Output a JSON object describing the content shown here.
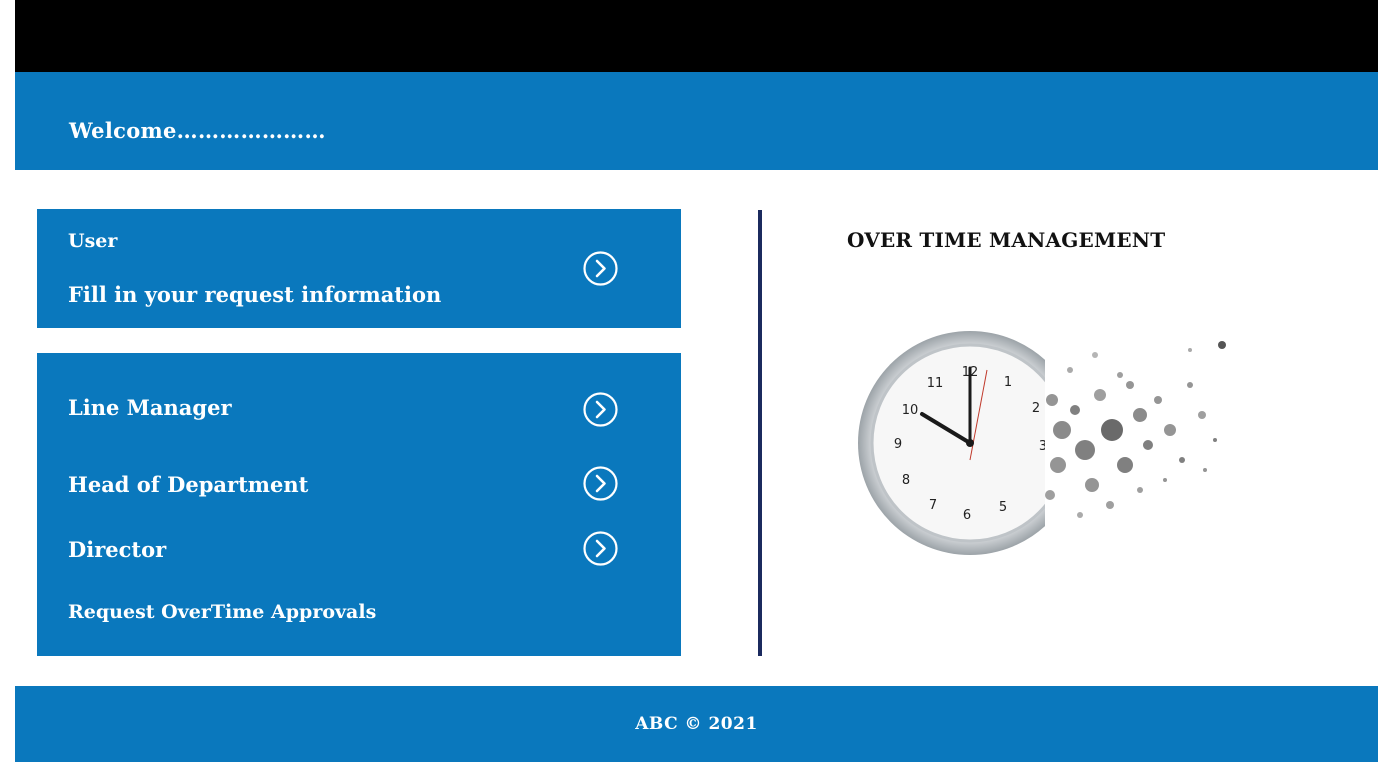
{
  "header": {
    "welcome_text": "Welcome…………………"
  },
  "user_panel": {
    "title": "User",
    "subtitle": "Fill in your request information",
    "arrow_icon": "chevron-right-circle-icon"
  },
  "approvers_panel": {
    "items": [
      {
        "label": "Line Manager"
      },
      {
        "label": "Head of Department"
      },
      {
        "label": "Director"
      }
    ],
    "subtitle": "Request OverTime Approvals",
    "arrow_icon": "chevron-right-circle-icon"
  },
  "main": {
    "title": "OVER TIME MANAGEMENT",
    "illustration": "disintegrating-clock",
    "clock_numerals": [
      "11",
      "12",
      "1",
      "2",
      "3",
      "10",
      "9",
      "8",
      "7",
      "6",
      "5"
    ]
  },
  "footer": {
    "text": "ABC © 2021"
  },
  "colors": {
    "primary_blue": "#0a78bd",
    "top_bar": "#000000",
    "divider": "#1b2a5e",
    "text_on_blue": "#ffffff"
  }
}
